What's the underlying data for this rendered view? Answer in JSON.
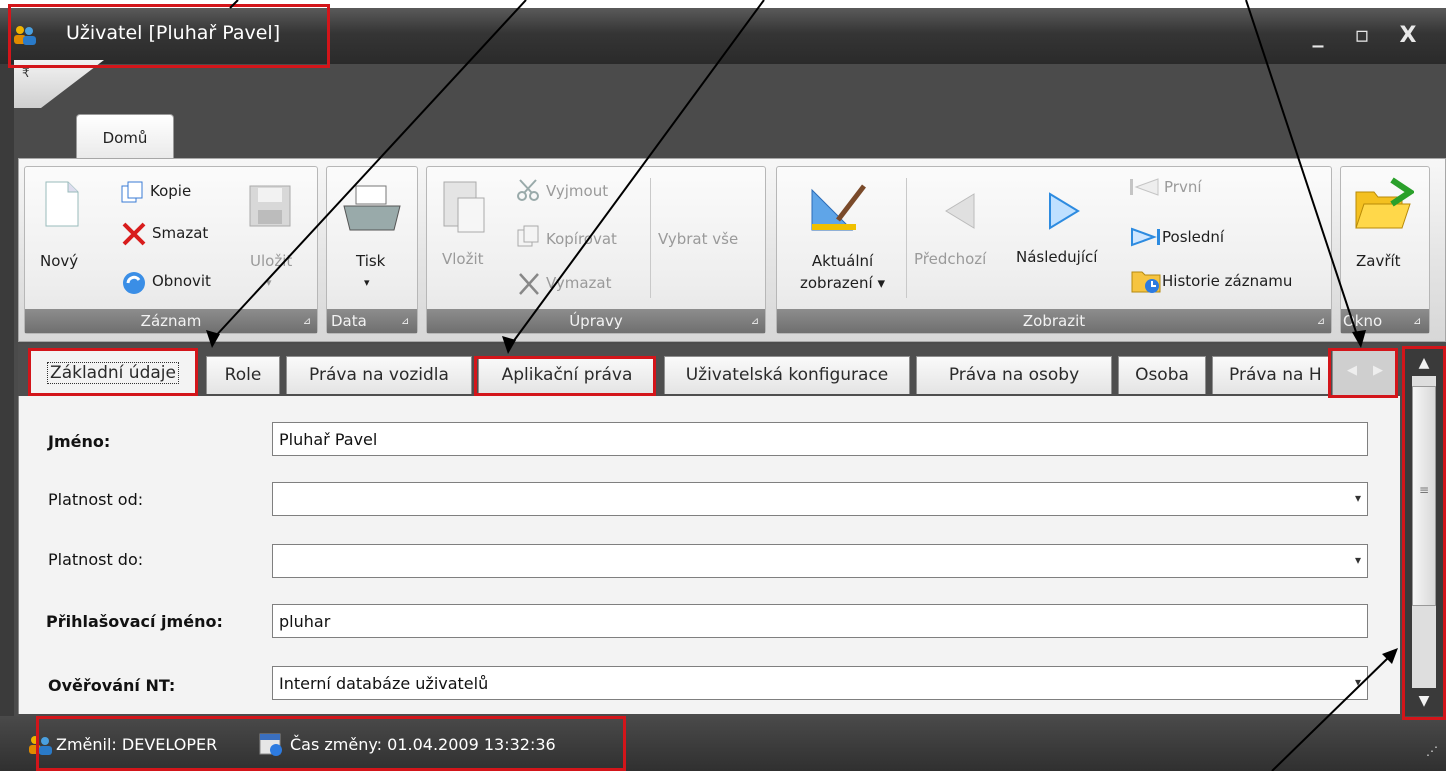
{
  "window": {
    "title": "Uživatel [Pluhař Pavel]",
    "controls": {
      "minimize": "_",
      "maximize": "▫",
      "close": "X"
    }
  },
  "ribbon": {
    "tab": "Domů",
    "groups": {
      "zaznam": {
        "label": "Záznam",
        "novy": "Nový",
        "kopie": "Kopie",
        "smazat": "Smazat",
        "obnovit": "Obnovit",
        "ulozit": "Uložit"
      },
      "data": {
        "label": "Data",
        "tisk": "Tisk"
      },
      "upravy": {
        "label": "Úpravy",
        "vlozit": "Vložit",
        "vyjmout": "Vyjmout",
        "kopirovat": "Kopírovat",
        "vymazat": "Vymazat",
        "vybrat_vse": "Vybrat vše"
      },
      "zobrazit": {
        "label": "Zobrazit",
        "aktualni_1": "Aktuální",
        "aktualni_2": "zobrazení ▾",
        "predchozi": "Předchozí",
        "nasledujici": "Následující",
        "prvni": "První",
        "posledni": "Poslední",
        "historie": "Historie záznamu"
      },
      "okno": {
        "label": "Okno",
        "zavrit": "Zavřít"
      }
    }
  },
  "tabs": [
    "Základní údaje",
    "Role",
    "Práva na vozidla",
    "Aplikační práva",
    "Uživatelská konfigurace",
    "Práva na osoby",
    "Osoba",
    "Práva na H"
  ],
  "form": {
    "jmeno": {
      "label": "Jméno:",
      "value": "Pluhař Pavel"
    },
    "platnost_od": {
      "label": "Platnost od:",
      "value": ""
    },
    "platnost_do": {
      "label": "Platnost do:",
      "value": ""
    },
    "login": {
      "label": "Přihlašovací jméno:",
      "value": "pluhar"
    },
    "overovani": {
      "label": "Ověřování NT:",
      "value": "Interní databáze uživatelů"
    }
  },
  "status": {
    "changed_by": "Změnil: DEVELOPER",
    "changed_at": "Čas změny: 01.04.2009 13:32:36"
  },
  "colors": {
    "annotation": "#d3151a",
    "nav_arrow": "#2d8be0"
  }
}
